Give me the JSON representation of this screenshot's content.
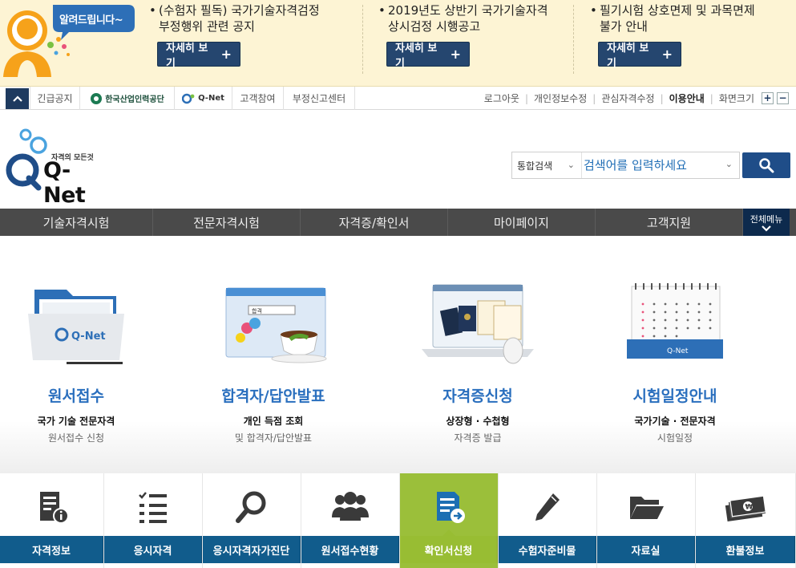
{
  "banner": {
    "bubble_text": "알려드립니다~",
    "notices": [
      {
        "line1": "(수험자 필독) 국가기술자격검정",
        "line2": "부정행위 관련 공지",
        "button": "자세히 보기"
      },
      {
        "line1": "2019년도 상반기 국가기술자격",
        "line2": "상시검정 시행공고",
        "button": "자세히 보기"
      },
      {
        "line1": "필기시험 상호면제 및 과목면제",
        "line2": "불가 안내",
        "button": "자세히 보기"
      }
    ]
  },
  "util": {
    "tabs": [
      "긴급공지",
      "한국산업인력공단",
      "Q-Net",
      "고객참여",
      "부정신고센터"
    ],
    "links": [
      "로그아웃",
      "개인정보수정",
      "관심자격수정",
      "이용안내",
      "화면크기"
    ],
    "zoom_in": "+",
    "zoom_out": "−"
  },
  "logo": {
    "tagline": "자격의 모든것",
    "name": "Q-Net"
  },
  "search": {
    "scope": "통합검색",
    "placeholder": "검색어를 입력하세요"
  },
  "gnb": {
    "items": [
      "기술자격시험",
      "전문자격시험",
      "자격증/확인서",
      "마이페이지",
      "고객지원"
    ],
    "all_menu": "전체메뉴"
  },
  "cards": [
    {
      "title": "원서접수",
      "desc1": "국가 기술 전문자격",
      "desc2": "원서접수 신청",
      "illus_text": "Q-Net"
    },
    {
      "title": "합격자/답안발표",
      "desc1": "개인 득점 조회",
      "desc2": "및 합격자/답안발표",
      "illus_text": "합격"
    },
    {
      "title": "자격증신청",
      "desc1": "상장형 · 수첩형",
      "desc2": "자격증 발급",
      "illus_text": ""
    },
    {
      "title": "시험일정안내",
      "desc1": "국가기술 · 전문자격",
      "desc2": "시험일정",
      "illus_text": "Q-Net"
    }
  ],
  "quick": {
    "items": [
      "자격정보",
      "응시자격",
      "응시자격자가진단",
      "원서접수현황",
      "확인서신청",
      "수험자준비물",
      "자료실",
      "환불정보"
    ],
    "active_index": 4
  },
  "colors": {
    "navy": "#1f4d88",
    "gnb": "#4a4a4a",
    "quick_blue": "#115c8c",
    "quick_active": "#98bd33",
    "card_title": "#2a6fbe",
    "banner_bg": "#fdf4d4"
  }
}
